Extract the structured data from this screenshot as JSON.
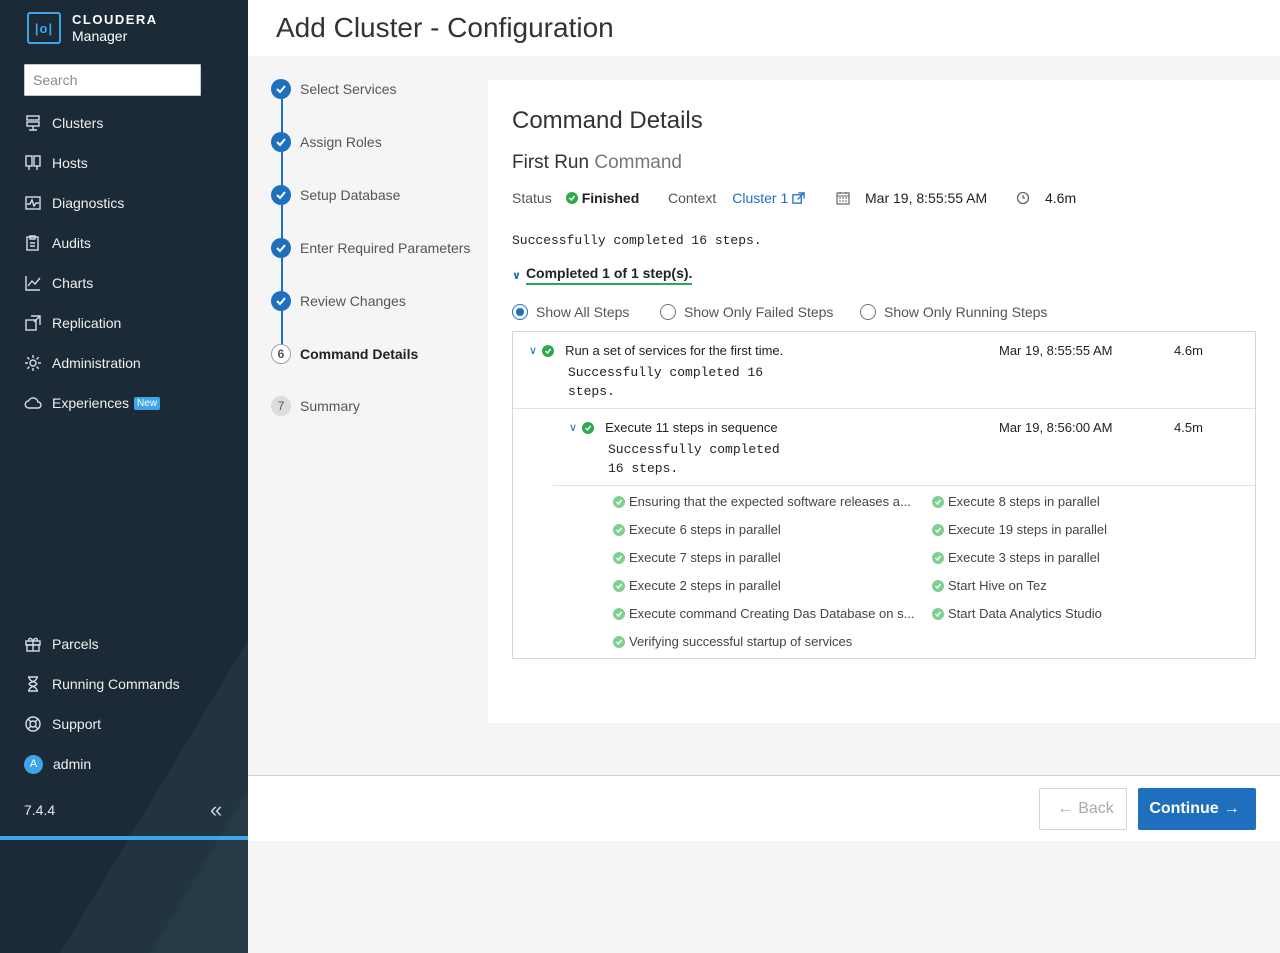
{
  "sidebar": {
    "brand": "CLOUDERA",
    "product": "Manager",
    "logo_mark": "|o|",
    "search_placeholder": "Search",
    "items": [
      {
        "label": "Clusters",
        "icon": "clusters-icon"
      },
      {
        "label": "Hosts",
        "icon": "hosts-icon"
      },
      {
        "label": "Diagnostics",
        "icon": "diagnostics-icon"
      },
      {
        "label": "Audits",
        "icon": "audits-icon"
      },
      {
        "label": "Charts",
        "icon": "charts-icon"
      },
      {
        "label": "Replication",
        "icon": "replication-icon"
      },
      {
        "label": "Administration",
        "icon": "gear-icon"
      },
      {
        "label": "Experiences",
        "icon": "cloud-icon",
        "badge": "New"
      }
    ],
    "bottom_items": [
      {
        "label": "Parcels",
        "icon": "gift-icon"
      },
      {
        "label": "Running Commands",
        "icon": "hourglass-icon"
      },
      {
        "label": "Support",
        "icon": "lifebuoy-icon"
      },
      {
        "label": "admin",
        "icon": "avatar",
        "initial": "A"
      }
    ],
    "version": "7.4.4",
    "collapse_glyph": "«"
  },
  "header": {
    "title": "Add Cluster - Configuration"
  },
  "wizard": {
    "steps": [
      {
        "label": "Select Services",
        "state": "done"
      },
      {
        "label": "Assign Roles",
        "state": "done"
      },
      {
        "label": "Setup Database",
        "state": "done"
      },
      {
        "label": "Enter Required Parameters",
        "state": "done"
      },
      {
        "label": "Review Changes",
        "state": "done"
      },
      {
        "label": "Command Details",
        "state": "active",
        "num": "6"
      },
      {
        "label": "Summary",
        "state": "pending",
        "num": "7"
      }
    ]
  },
  "command": {
    "section_title": "Command Details",
    "title_main": "First Run",
    "title_sub": "Command",
    "status_label": "Status",
    "status_value": "Finished",
    "context_label": "Context",
    "context_value": "Cluster 1",
    "start_time": "Mar 19, 8:55:55 AM",
    "duration": "4.6m",
    "message": "Successfully completed 16 steps.",
    "completed_text": "Completed 1 of 1 step(s).",
    "filters": [
      "Show All Steps",
      "Show Only Failed Steps",
      "Show Only Running Steps"
    ],
    "selected_filter": "Show All Steps",
    "steps": [
      {
        "name": "Run a set of services for the first time.",
        "message_line1": "Successfully completed 16",
        "message_line2": "steps.",
        "date": "Mar 19, 8:55:55 AM",
        "duration": "4.6m"
      },
      {
        "name": "Execute 11 steps in sequence",
        "message_line1": "Successfully completed",
        "message_line2": "16 steps.",
        "date": "Mar 19, 8:56:00 AM",
        "duration": "4.5m"
      }
    ],
    "substeps_left": [
      "Ensuring that the expected software releases a...",
      "Execute 6 steps in parallel",
      "Execute 7 steps in parallel",
      "Execute 2 steps in parallel",
      "Execute command Creating Das Database on s...",
      "Verifying successful startup of services"
    ],
    "substeps_right": [
      "Execute 8 steps in parallel",
      "Execute 19 steps in parallel",
      "Execute 3 steps in parallel",
      "Start Hive on Tez",
      "Start Data Analytics Studio"
    ]
  },
  "footer": {
    "back_label": "Back",
    "continue_label": "Continue",
    "back_arrow": "←",
    "continue_arrow": "→"
  },
  "colors": {
    "sidebar_bg": "#1b2a36",
    "accent": "#1f6fbf",
    "success": "#2eaa4c",
    "highlight": "#3ea6e8"
  }
}
